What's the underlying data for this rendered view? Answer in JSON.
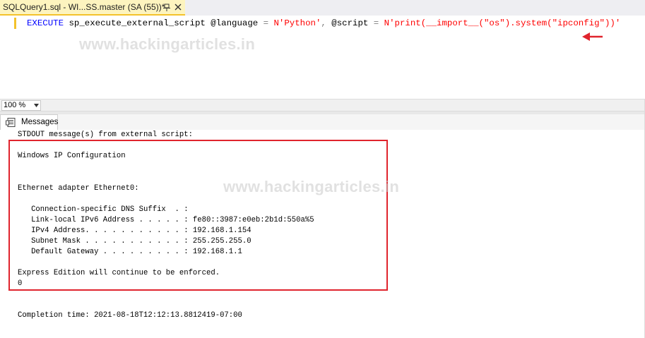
{
  "tab": {
    "title": "SQLQuery1.sql - WI...SS.master (SA (55))*",
    "pin_icon": "pin-icon",
    "close_icon": "close-icon"
  },
  "editor": {
    "code": {
      "keyword": "EXECUTE",
      "proc": "sp_execute_external_script",
      "param1": "@language",
      "eq1": "=",
      "lang_value": "N'Python'",
      "comma": ",",
      "param2": "@script",
      "eq2": "=",
      "script_value": "N'print(__import__(\"os\").system(\"ipconfig\"))'"
    },
    "annotation_arrow_color": "#e0242d"
  },
  "watermark": "www.hackingarticles.in",
  "zoom": {
    "value": "100 %"
  },
  "results": {
    "tab_label": "Messages",
    "lines": {
      "header": "STDOUT message(s) from external script:",
      "ipconfig_title": "Windows IP Configuration",
      "adapter": "Ethernet adapter Ethernet0:",
      "dns_suffix": "   Connection-specific DNS Suffix  . :",
      "ipv6": "   Link-local IPv6 Address . . . . . : fe80::3987:e0eb:2b1d:550a%5",
      "ipv4": "   IPv4 Address. . . . . . . . . . . : 192.168.1.154",
      "subnet": "   Subnet Mask . . . . . . . . . . . : 255.255.255.0",
      "gateway": "   Default Gateway . . . . . . . . . : 192.168.1.1",
      "edition": "Express Edition will continue to be enforced.",
      "return_code": "0",
      "completion": "Completion time: 2021-08-18T12:12:13.8812419-07:00"
    },
    "highlight_color": "#e0242d"
  }
}
